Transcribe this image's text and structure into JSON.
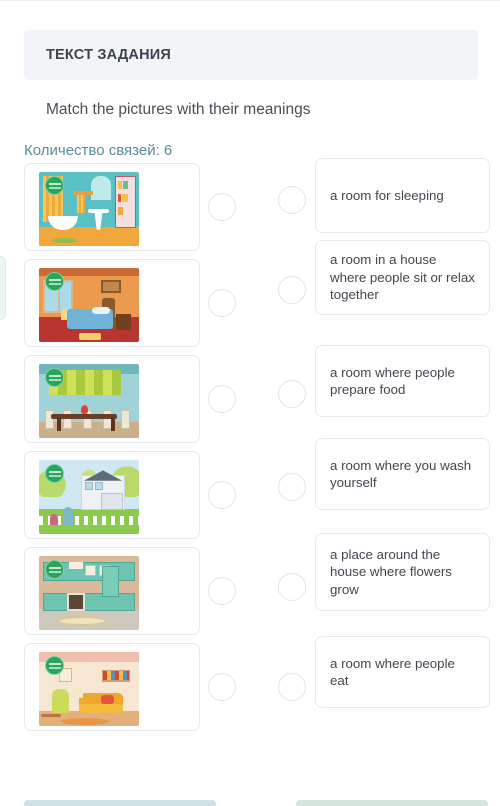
{
  "header": {
    "title": "ТЕКСТ ЗАДАНИЯ"
  },
  "instruction": "Match the pictures with their meanings",
  "link_count_label": "Количество связей: 6",
  "colors": {
    "header_bg": "#f2f4f8",
    "header_text": "#3b4453",
    "accent_teal": "#5b8c9b",
    "card_border": "#e6e9ed",
    "circle_border": "#e2e5e9",
    "badge_green": "#2aa55e"
  },
  "rows": [
    {
      "image_alt": "bathroom with bathtub, sink, mirror and orange curtain",
      "badge": "watermark-badge",
      "definition": "a room for sleeping"
    },
    {
      "image_alt": "bedroom with blue bed, orange walls and window",
      "badge": "watermark-badge",
      "definition": "a room in a house where people sit or relax together"
    },
    {
      "image_alt": "dining room with long wooden table and chairs",
      "badge": "watermark-badge",
      "definition": "a room where people prepare food"
    },
    {
      "image_alt": "house exterior with garden, lawn and white fence",
      "badge": "watermark-badge",
      "definition": "a room where you wash yourself"
    },
    {
      "image_alt": "kitchen with green cabinets, oven and fridge",
      "badge": "watermark-badge",
      "definition": "a place around the house where flowers grow"
    },
    {
      "image_alt": "living room with yellow sofa, green armchair and bookshelf",
      "badge": "watermark-badge",
      "definition": "a room where people eat"
    }
  ],
  "footer": {
    "left_button": "",
    "right_button": ""
  }
}
